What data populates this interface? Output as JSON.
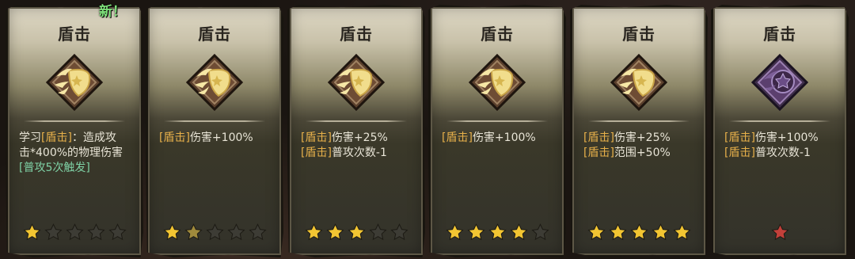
{
  "new_badge": "新！",
  "cards": [
    {
      "title": "盾击",
      "icon": "shield-burst-icon",
      "rarity": "gold",
      "desc_lines": [
        [
          {
            "t": "学习",
            "c": "w"
          },
          {
            "t": "[盾击]",
            "c": "hl"
          },
          {
            "t": "：造成攻",
            "c": "w"
          }
        ],
        [
          {
            "t": "击*400%的物理伤害",
            "c": "w"
          }
        ],
        [
          {
            "t": "[普攻5次触发]",
            "c": "green"
          }
        ]
      ],
      "stars": [
        1,
        0,
        0,
        0,
        0
      ]
    },
    {
      "title": "盾击",
      "icon": "shield-burst-icon",
      "rarity": "gold",
      "desc_lines": [
        [
          {
            "t": "[盾击]",
            "c": "hl"
          },
          {
            "t": "伤害+100%",
            "c": "w"
          }
        ]
      ],
      "stars": [
        1,
        0.5,
        0,
        0,
        0
      ]
    },
    {
      "title": "盾击",
      "icon": "shield-burst-icon",
      "rarity": "gold",
      "desc_lines": [
        [
          {
            "t": "[盾击]",
            "c": "hl"
          },
          {
            "t": "伤害+25%",
            "c": "w"
          }
        ],
        [
          {
            "t": "[盾击]",
            "c": "hl"
          },
          {
            "t": "普攻次数-1",
            "c": "w"
          }
        ]
      ],
      "stars": [
        1,
        1,
        1,
        0,
        0
      ]
    },
    {
      "title": "盾击",
      "icon": "shield-burst-icon",
      "rarity": "gold",
      "desc_lines": [
        [
          {
            "t": "[盾击]",
            "c": "hl"
          },
          {
            "t": "伤害+100%",
            "c": "w"
          }
        ]
      ],
      "stars": [
        1,
        1,
        1,
        1,
        0
      ]
    },
    {
      "title": "盾击",
      "icon": "shield-burst-icon",
      "rarity": "gold",
      "desc_lines": [
        [
          {
            "t": "[盾击]",
            "c": "hl"
          },
          {
            "t": "伤害+25%",
            "c": "w"
          }
        ],
        [
          {
            "t": "[盾击]",
            "c": "hl"
          },
          {
            "t": "范围+50%",
            "c": "w"
          }
        ]
      ],
      "stars": [
        1,
        1,
        1,
        1,
        1
      ]
    },
    {
      "title": "盾击",
      "icon": "shield-burst-icon",
      "rarity": "purple",
      "desc_lines": [
        [
          {
            "t": "[盾击]",
            "c": "hl"
          },
          {
            "t": "伤害+100%",
            "c": "w"
          }
        ],
        [
          {
            "t": "[盾击]",
            "c": "hl"
          },
          {
            "t": "普攻次数-1",
            "c": "w"
          }
        ]
      ],
      "stars": [
        "red"
      ]
    }
  ],
  "colors": {
    "star_gold": "#f2c532",
    "star_empty": "#3d3c35",
    "star_red": "#c2403a",
    "highlight": "#e7b04a",
    "trigger_text": "#7ed0a4"
  }
}
